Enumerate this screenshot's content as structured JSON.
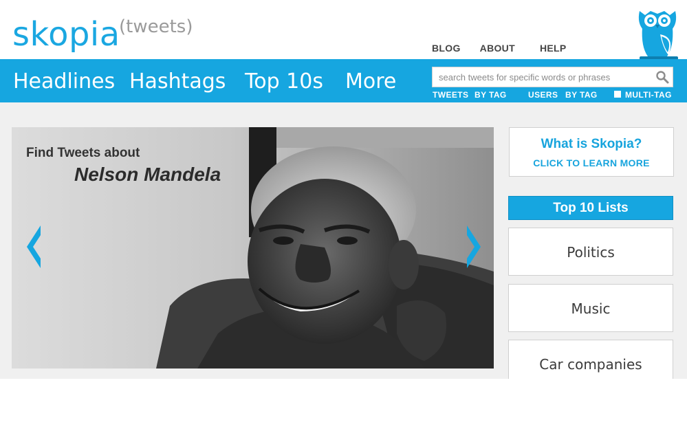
{
  "brand": {
    "name": "skopia",
    "suffix": "(tweets)",
    "color": "#1aa7e1"
  },
  "top_links": [
    {
      "label": "BLOG"
    },
    {
      "label": "ABOUT"
    },
    {
      "label": "HELP"
    }
  ],
  "nav": {
    "bg_color": "#16a6e0",
    "items": [
      {
        "label": "Headlines"
      },
      {
        "label": "Hashtags"
      },
      {
        "label": "Top 10s"
      },
      {
        "label": "More"
      }
    ]
  },
  "search": {
    "placeholder": "search tweets for specific words or phrases",
    "value": "",
    "button_icon": "search-icon",
    "options": {
      "tweets": "TWEETS",
      "tweets_by_tag": "BY TAG",
      "users": "USERS",
      "users_by_tag": "BY TAG",
      "multi_tag": "MULTI-TAG",
      "multi_tag_checked": false
    }
  },
  "hero": {
    "kicker": "Find Tweets about",
    "subject": "Nelson Mandela",
    "prev_icon": "chevron-left-icon",
    "next_icon": "chevron-right-icon"
  },
  "about": {
    "title": "What is Skopia?",
    "link": "CLICK TO LEARN MORE"
  },
  "top10": {
    "title": "Top 10 Lists",
    "lists": [
      {
        "label": "Politics"
      },
      {
        "label": "Music"
      },
      {
        "label": "Car companies"
      }
    ]
  },
  "mascot_icon": "owl-icon"
}
